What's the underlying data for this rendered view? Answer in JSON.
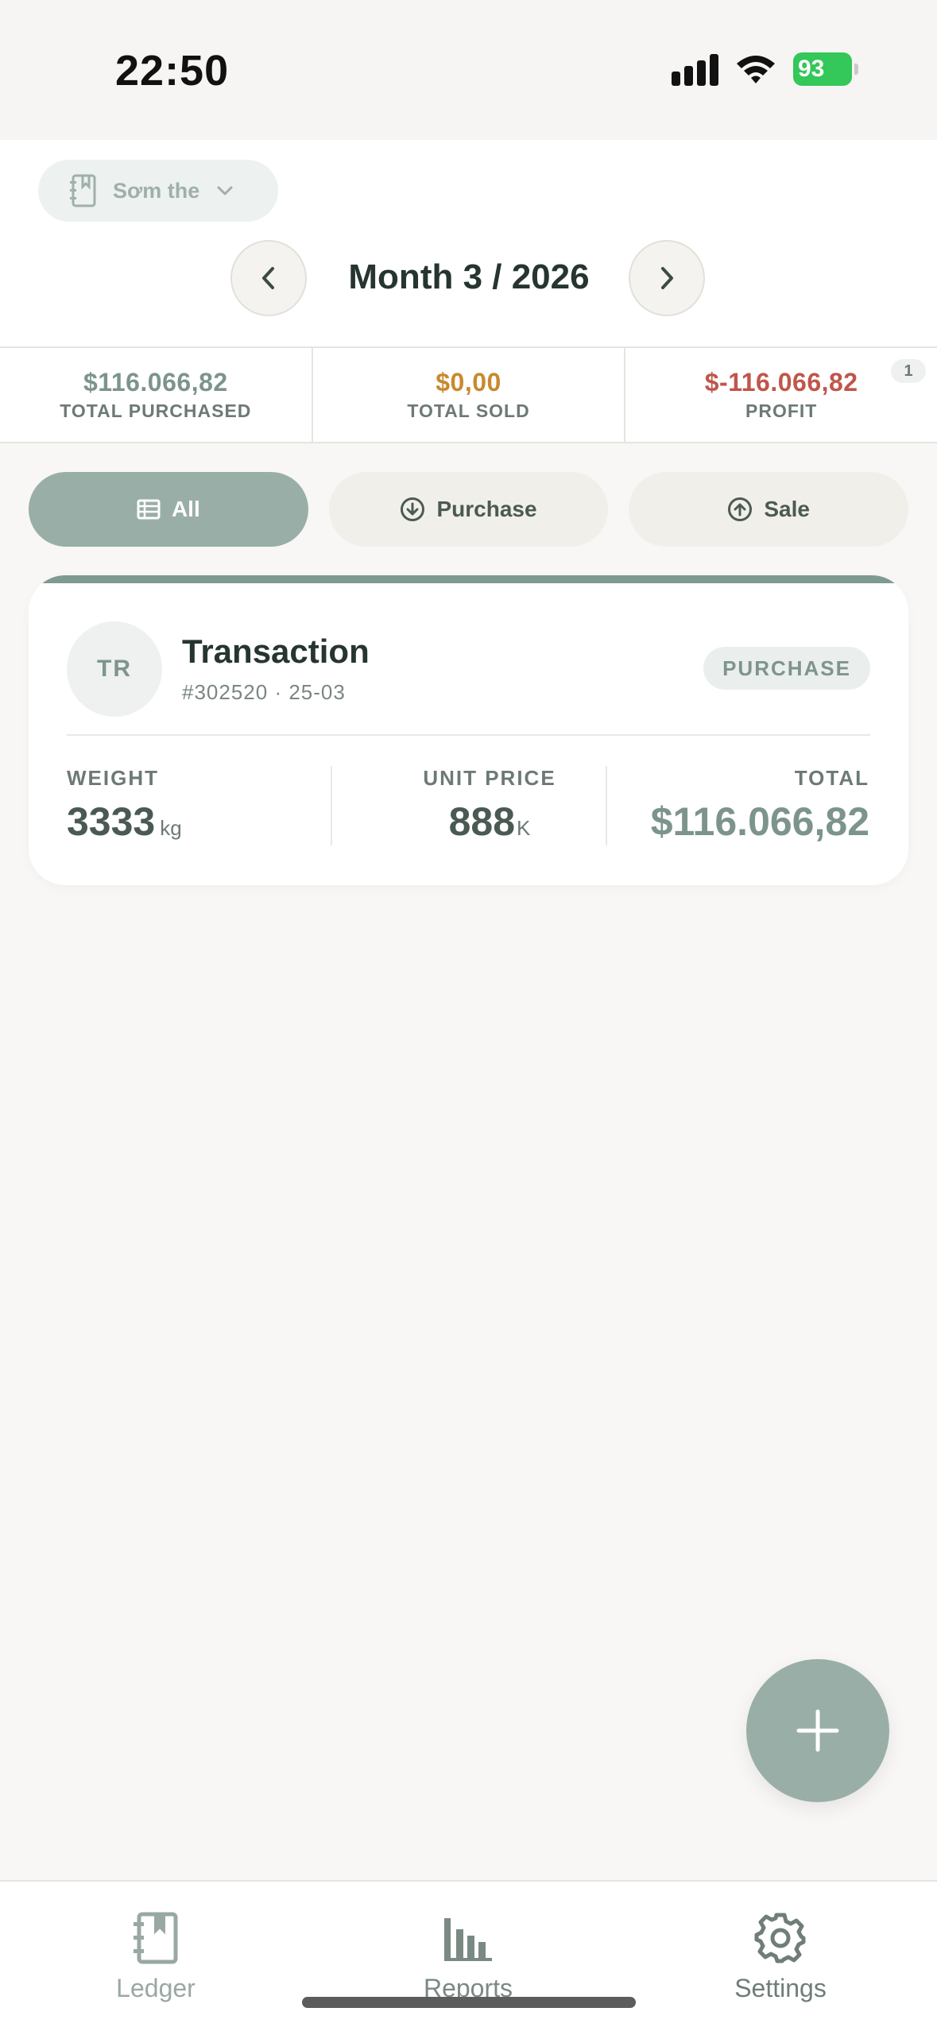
{
  "status_bar": {
    "time": "22:50",
    "battery": "93"
  },
  "header": {
    "ledger_name": "Sơm the",
    "month_title": "Month 3 / 2026"
  },
  "summary": {
    "purchased_value": "$116.066,82",
    "purchased_label": "TOTAL PURCHASED",
    "sold_value": "$0,00",
    "sold_label": "TOTAL SOLD",
    "profit_value": "$-116.066,82",
    "profit_label": "PROFIT",
    "count": "1"
  },
  "filters": [
    {
      "label": "All",
      "icon": "list-icon",
      "active": true
    },
    {
      "label": "Purchase",
      "icon": "arrow-down-circle-icon",
      "active": false
    },
    {
      "label": "Sale",
      "icon": "arrow-up-circle-icon",
      "active": false
    }
  ],
  "transaction": {
    "initials": "TR",
    "title": "Transaction",
    "subtitle": "#302520 · 25-03",
    "type": "PURCHASE",
    "weight_label": "WEIGHT",
    "weight_value": "3333",
    "weight_unit": "kg",
    "unit_price_label": "UNIT PRICE",
    "unit_price_value": "888",
    "unit_price_unit": "K",
    "total_label": "TOTAL",
    "total_value": "$116.066,82"
  },
  "tabbar": {
    "ledger": "Ledger",
    "reports": "Reports",
    "settings": "Settings"
  },
  "colors": {
    "accent": "#9aaea8",
    "purchase": "#7c948c",
    "sold": "#c8892e",
    "profit": "#c0564a",
    "battery": "#34c759"
  }
}
